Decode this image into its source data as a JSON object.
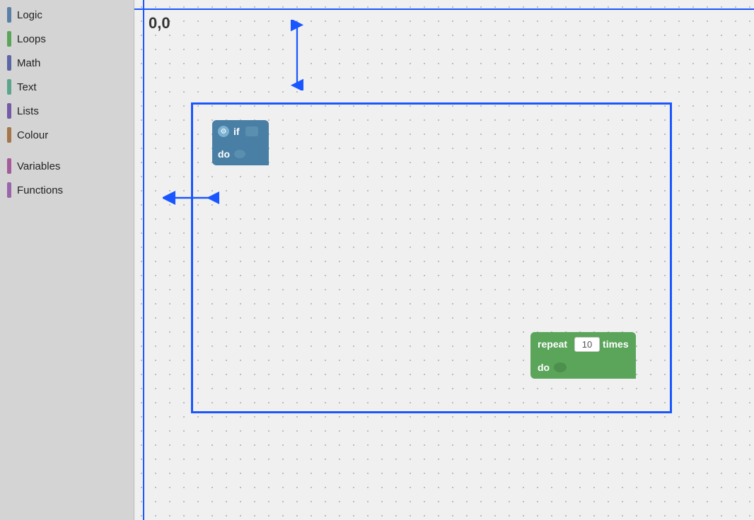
{
  "sidebar": {
    "items": [
      {
        "label": "Logic",
        "color": "#5b80a5",
        "id": "logic"
      },
      {
        "label": "Loops",
        "color": "#5ba55b",
        "id": "loops"
      },
      {
        "label": "Math",
        "color": "#5b67a5",
        "id": "math"
      },
      {
        "label": "Text",
        "color": "#5ba58c",
        "id": "text"
      },
      {
        "label": "Lists",
        "color": "#745ba5",
        "id": "lists"
      },
      {
        "label": "Colour",
        "color": "#a5754b",
        "id": "colour"
      }
    ],
    "divider": true,
    "extra_items": [
      {
        "label": "Variables",
        "color": "#a55b99",
        "id": "variables"
      },
      {
        "label": "Functions",
        "color": "#9966aa",
        "id": "functions"
      }
    ]
  },
  "canvas": {
    "coord_label": "0,0",
    "if_block": {
      "if_label": "if",
      "do_label": "do"
    },
    "repeat_block": {
      "repeat_label": "repeat",
      "value": "10",
      "times_label": "times",
      "do_label": "do"
    }
  }
}
